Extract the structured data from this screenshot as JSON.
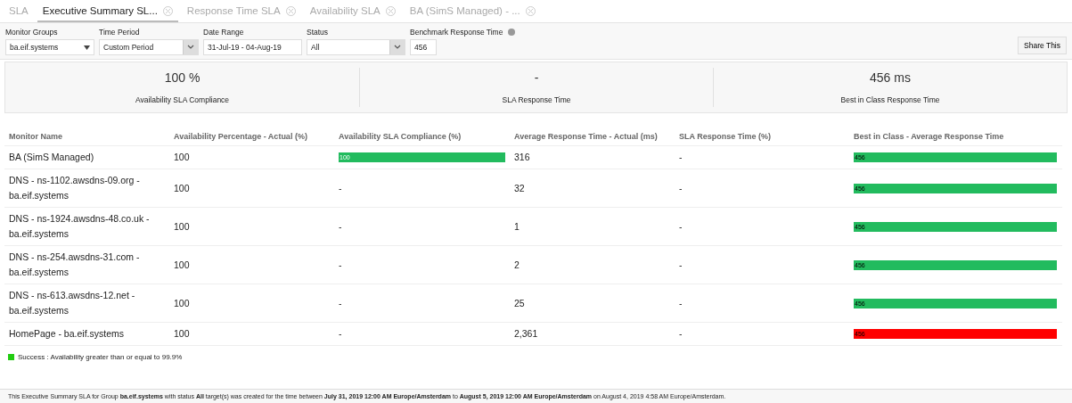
{
  "tabs": [
    {
      "label": "SLA",
      "selected": false,
      "closable": false
    },
    {
      "label": "Executive Summary SL...",
      "selected": true,
      "closable": true
    },
    {
      "label": "Response Time SLA",
      "selected": false,
      "closable": true
    },
    {
      "label": "Availability SLA",
      "selected": false,
      "closable": true
    },
    {
      "label": "BA (SimS Managed) - ...",
      "selected": false,
      "closable": true
    }
  ],
  "filters": [
    {
      "label": "Monitor Groups",
      "kind": "plain-select",
      "value": "ba.eif.systems"
    },
    {
      "label": "Time Period",
      "kind": "select",
      "value": "Custom Period"
    },
    {
      "label": "Date Range",
      "kind": "input",
      "value": "31-Jul-19 - 04-Aug-19"
    },
    {
      "label": "Status",
      "kind": "select",
      "value": "All"
    },
    {
      "label": "Benchmark Response Time",
      "kind": "short-input",
      "value": "456",
      "info": true
    }
  ],
  "share_button": "Share This",
  "summary": [
    {
      "value": "100 %",
      "label": "Availability SLA Compliance"
    },
    {
      "value": "-",
      "label": "SLA Response Time"
    },
    {
      "value": "456 ms",
      "label": "Best in Class Response Time"
    }
  ],
  "table": {
    "columns": [
      "Monitor Name",
      "Availability Percentage - Actual (%)",
      "Availability SLA Compliance (%)",
      "Average Response Time - Actual (ms)",
      "SLA Response Time (%)",
      "Best in Class - Average Response Time"
    ],
    "rows": [
      {
        "name": "BA (SimS Managed)",
        "availability": "100",
        "compliance": {
          "kind": "bar",
          "text": "100",
          "color": "#22bb5e"
        },
        "average": "316",
        "sla": "-",
        "best": {
          "kind": "bar",
          "text": "456",
          "color": "#22bb5e"
        }
      },
      {
        "name": "DNS - ns-1102.awsdns-09.org - ba.eif.systems",
        "availability": "100",
        "compliance": {
          "kind": "text",
          "text": "-"
        },
        "average": "32",
        "sla": "-",
        "best": {
          "kind": "bar",
          "text": "456",
          "color": "#22bb5e"
        }
      },
      {
        "name": "DNS - ns-1924.awsdns-48.co.uk - ba.eif.systems",
        "availability": "100",
        "compliance": {
          "kind": "text",
          "text": "-"
        },
        "average": "1",
        "sla": "-",
        "best": {
          "kind": "bar",
          "text": "456",
          "color": "#22bb5e"
        }
      },
      {
        "name": "DNS - ns-254.awsdns-31.com - ba.eif.systems",
        "availability": "100",
        "compliance": {
          "kind": "text",
          "text": "-"
        },
        "average": "2",
        "sla": "-",
        "best": {
          "kind": "bar",
          "text": "456",
          "color": "#22bb5e"
        }
      },
      {
        "name": "DNS - ns-613.awsdns-12.net - ba.eif.systems",
        "availability": "100",
        "compliance": {
          "kind": "text",
          "text": "-"
        },
        "average": "25",
        "sla": "-",
        "best": {
          "kind": "bar",
          "text": "456",
          "color": "#22bb5e"
        }
      },
      {
        "name": "HomePage - ba.eif.systems",
        "availability": "100",
        "compliance": {
          "kind": "text",
          "text": "-"
        },
        "average": "2,361",
        "sla": "-",
        "best": {
          "kind": "bar",
          "text": "456",
          "color": "#ff0000"
        }
      }
    ]
  },
  "legend": {
    "color": "#22cc11",
    "text": "Success : Availability greater than or equal to 99.9%"
  },
  "footer": "This Executive Summary SLA for Group **ba.eif.systems** with status **All** target(s) was created for the time between **July 31, 2019 12:00 AM Europe/Amsterdam** to **August 5, 2019 12:00 AM Europe/Amsterdam** on August 4, 2019 4:58 AM Europe/Amsterdam."
}
